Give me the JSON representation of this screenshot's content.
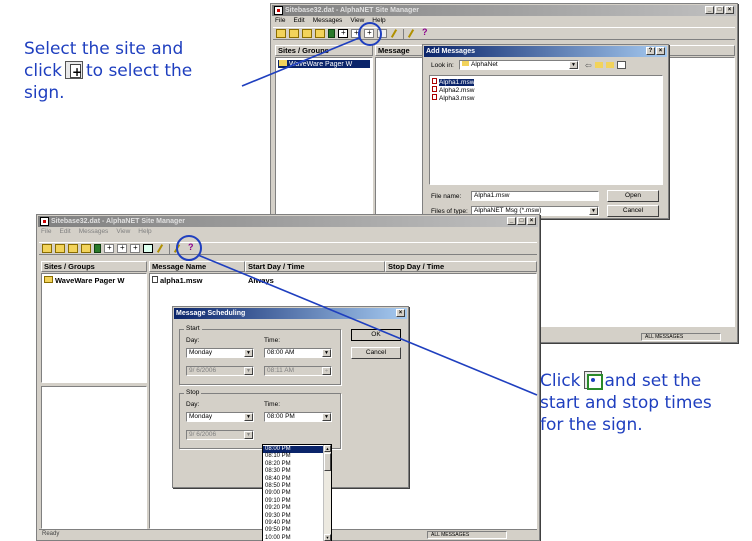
{
  "annotations": {
    "left_line1": "Select the site and",
    "left_line2_pre": "click",
    "left_line2_post": "to select the",
    "left_line3": "sign.",
    "right_line1_pre": "Click",
    "right_line1_post": "and set the",
    "right_line2": "start and stop times",
    "right_line3": "for the sign."
  },
  "back_window": {
    "title": "Sitebase32.dat - AlphaNET Site Manager",
    "menu": [
      "File",
      "Edit",
      "Messages",
      "View",
      "Help"
    ],
    "col_sites": "Sites / Groups",
    "col_message": "Message",
    "site_item": "WaveWare Pager W",
    "status_right": "ALL MESSAGES"
  },
  "add_messages": {
    "title": "Add Messages",
    "help_btn": "?",
    "close_btn": "×",
    "look_in_label": "Look in:",
    "look_in_value": "AlphaNet",
    "files": [
      "Alpha1.msw",
      "Alpha2.msw",
      "Alpha3.msw"
    ],
    "file_name_label": "File name:",
    "file_name_value": "Alpha1.msw",
    "files_of_type_label": "Files of type:",
    "files_of_type_value": "AlphaNET Msg (*.msw)",
    "open_btn": "Open",
    "cancel_btn": "Cancel"
  },
  "front_window": {
    "title": "Sitebase32.dat - AlphaNET Site Manager",
    "menu": [
      "File",
      "Edit",
      "Messages",
      "View",
      "Help"
    ],
    "col_sites": "Sites / Groups",
    "col_message": "Message Name",
    "col_start": "Start Day / Time",
    "col_stop": "Stop Day / Time",
    "site_item": "WaveWare Pager W",
    "message_row": {
      "name": "alpha1.msw",
      "start": "Always"
    },
    "status_left": "Ready",
    "status_right": "ALL MESSAGES"
  },
  "scheduling": {
    "title": "Message Scheduling",
    "close_btn": "×",
    "start_group": "Start",
    "stop_group": "Stop",
    "day_label": "Day:",
    "time_label": "Time:",
    "start_day": "Monday",
    "start_time": "08:00 AM",
    "start_date": "9/ 6/2006",
    "start_time2": "08:11 AM",
    "stop_day": "Monday",
    "stop_time": "08:00 PM",
    "stop_date": "9/ 6/2006",
    "ok_btn": "OK",
    "cancel_btn": "Cancel",
    "time_options": [
      "08:00 PM",
      "08:10 PM",
      "08:20 PM",
      "08:30 PM",
      "08:40 PM",
      "08:50 PM",
      "09:00 PM",
      "09:10 PM",
      "09:20 PM",
      "09:30 PM",
      "09:40 PM",
      "09:50 PM",
      "10:00 PM"
    ],
    "selected_time_index": 0
  },
  "colors": {
    "annotation_blue": "#1f3fbf",
    "titlebar_active": "#0a246a",
    "window_face": "#d4d0c8"
  }
}
